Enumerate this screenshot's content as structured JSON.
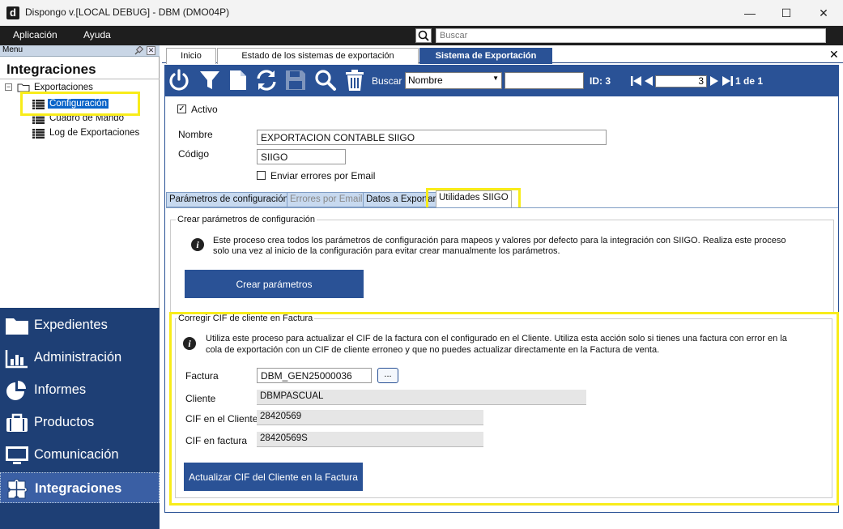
{
  "window": {
    "title": "Dispongo v.[LOCAL DEBUG] - DBM (DMO04P)",
    "app_icon_letter": "d",
    "minimize": "—",
    "maximize": "☐",
    "close": "✕"
  },
  "menubar": {
    "items": [
      "Aplicación",
      "Ayuda"
    ],
    "search_placeholder": "Buscar"
  },
  "left": {
    "header": "Menu",
    "title": "Integraciones",
    "tree": {
      "root": "Exportaciones",
      "children": [
        "Configuración",
        "Cuadro de Mando",
        "Log de Exportaciones"
      ],
      "selected": "Configuración"
    },
    "nav": [
      "Expedientes",
      "Administración",
      "Informes",
      "Productos",
      "Comunicación",
      "Integraciones"
    ],
    "active_nav": "Integraciones"
  },
  "tabs": [
    "Inicio",
    "Estado de los sistemas de exportación",
    "Sistema de Exportación"
  ],
  "active_tab": "Sistema de Exportación",
  "toolbar": {
    "buscar_label": "Buscar",
    "buscar_field": "Nombre",
    "search_value": "",
    "id_label": "ID: 3",
    "page_value": "3",
    "page_of": "1 de 1"
  },
  "form": {
    "activo_label": "Activo",
    "activo_checked": true,
    "nombre_label": "Nombre",
    "nombre_value": "EXPORTACION CONTABLE SIIGO",
    "codigo_label": "Código",
    "codigo_value": "SIIGO",
    "email_errores_label": "Enviar errores por Email",
    "email_errores_checked": false
  },
  "subtabs": [
    "Parámetros de configuración",
    "Errores por Email",
    "Datos a Exportar",
    "Utilidades SIIGO"
  ],
  "active_subtab": "Utilidades SIIGO",
  "crear": {
    "group_title": "Crear parámetros de configuración",
    "text_line1": "Este proceso crea todos los parámetros de configuración para mapeos y valores por defecto para la integración con SIIGO. Realiza este proceso",
    "text_line2": "solo una vez al inicio de la configuración para evitar crear manualmente los parámetros.",
    "button": "Crear parámetros"
  },
  "corregir": {
    "group_title": "Corregir CIF de cliente en Factura",
    "text_line1": "Utiliza este proceso para actualizar el CIF de la factura con el configurado en el Cliente. Utiliza esta acción solo si tienes una factura con error en la",
    "text_line2": "cola de exportación con un CIF de cliente erroneo y que no puedes actualizar directamente en la Factura de venta.",
    "factura_label": "Factura",
    "factura_value": "DBM_GEN25000036",
    "browse_label": "...",
    "cliente_label": "Cliente",
    "cliente_value": "DBMPASCUAL",
    "cif_cliente_label": "CIF en el Cliente",
    "cif_cliente_value": "28420569",
    "cif_factura_label": "CIF en factura",
    "cif_factura_value": "28420569S",
    "button": "Actualizar CIF del Cliente en la Factura"
  },
  "colors": {
    "menubar": "#1e1e1e",
    "primary": "#2a5296",
    "nav_bg": "#1e3f75",
    "highlight": "#f8ec1a",
    "subtab_bg": "#c7d9ef"
  }
}
